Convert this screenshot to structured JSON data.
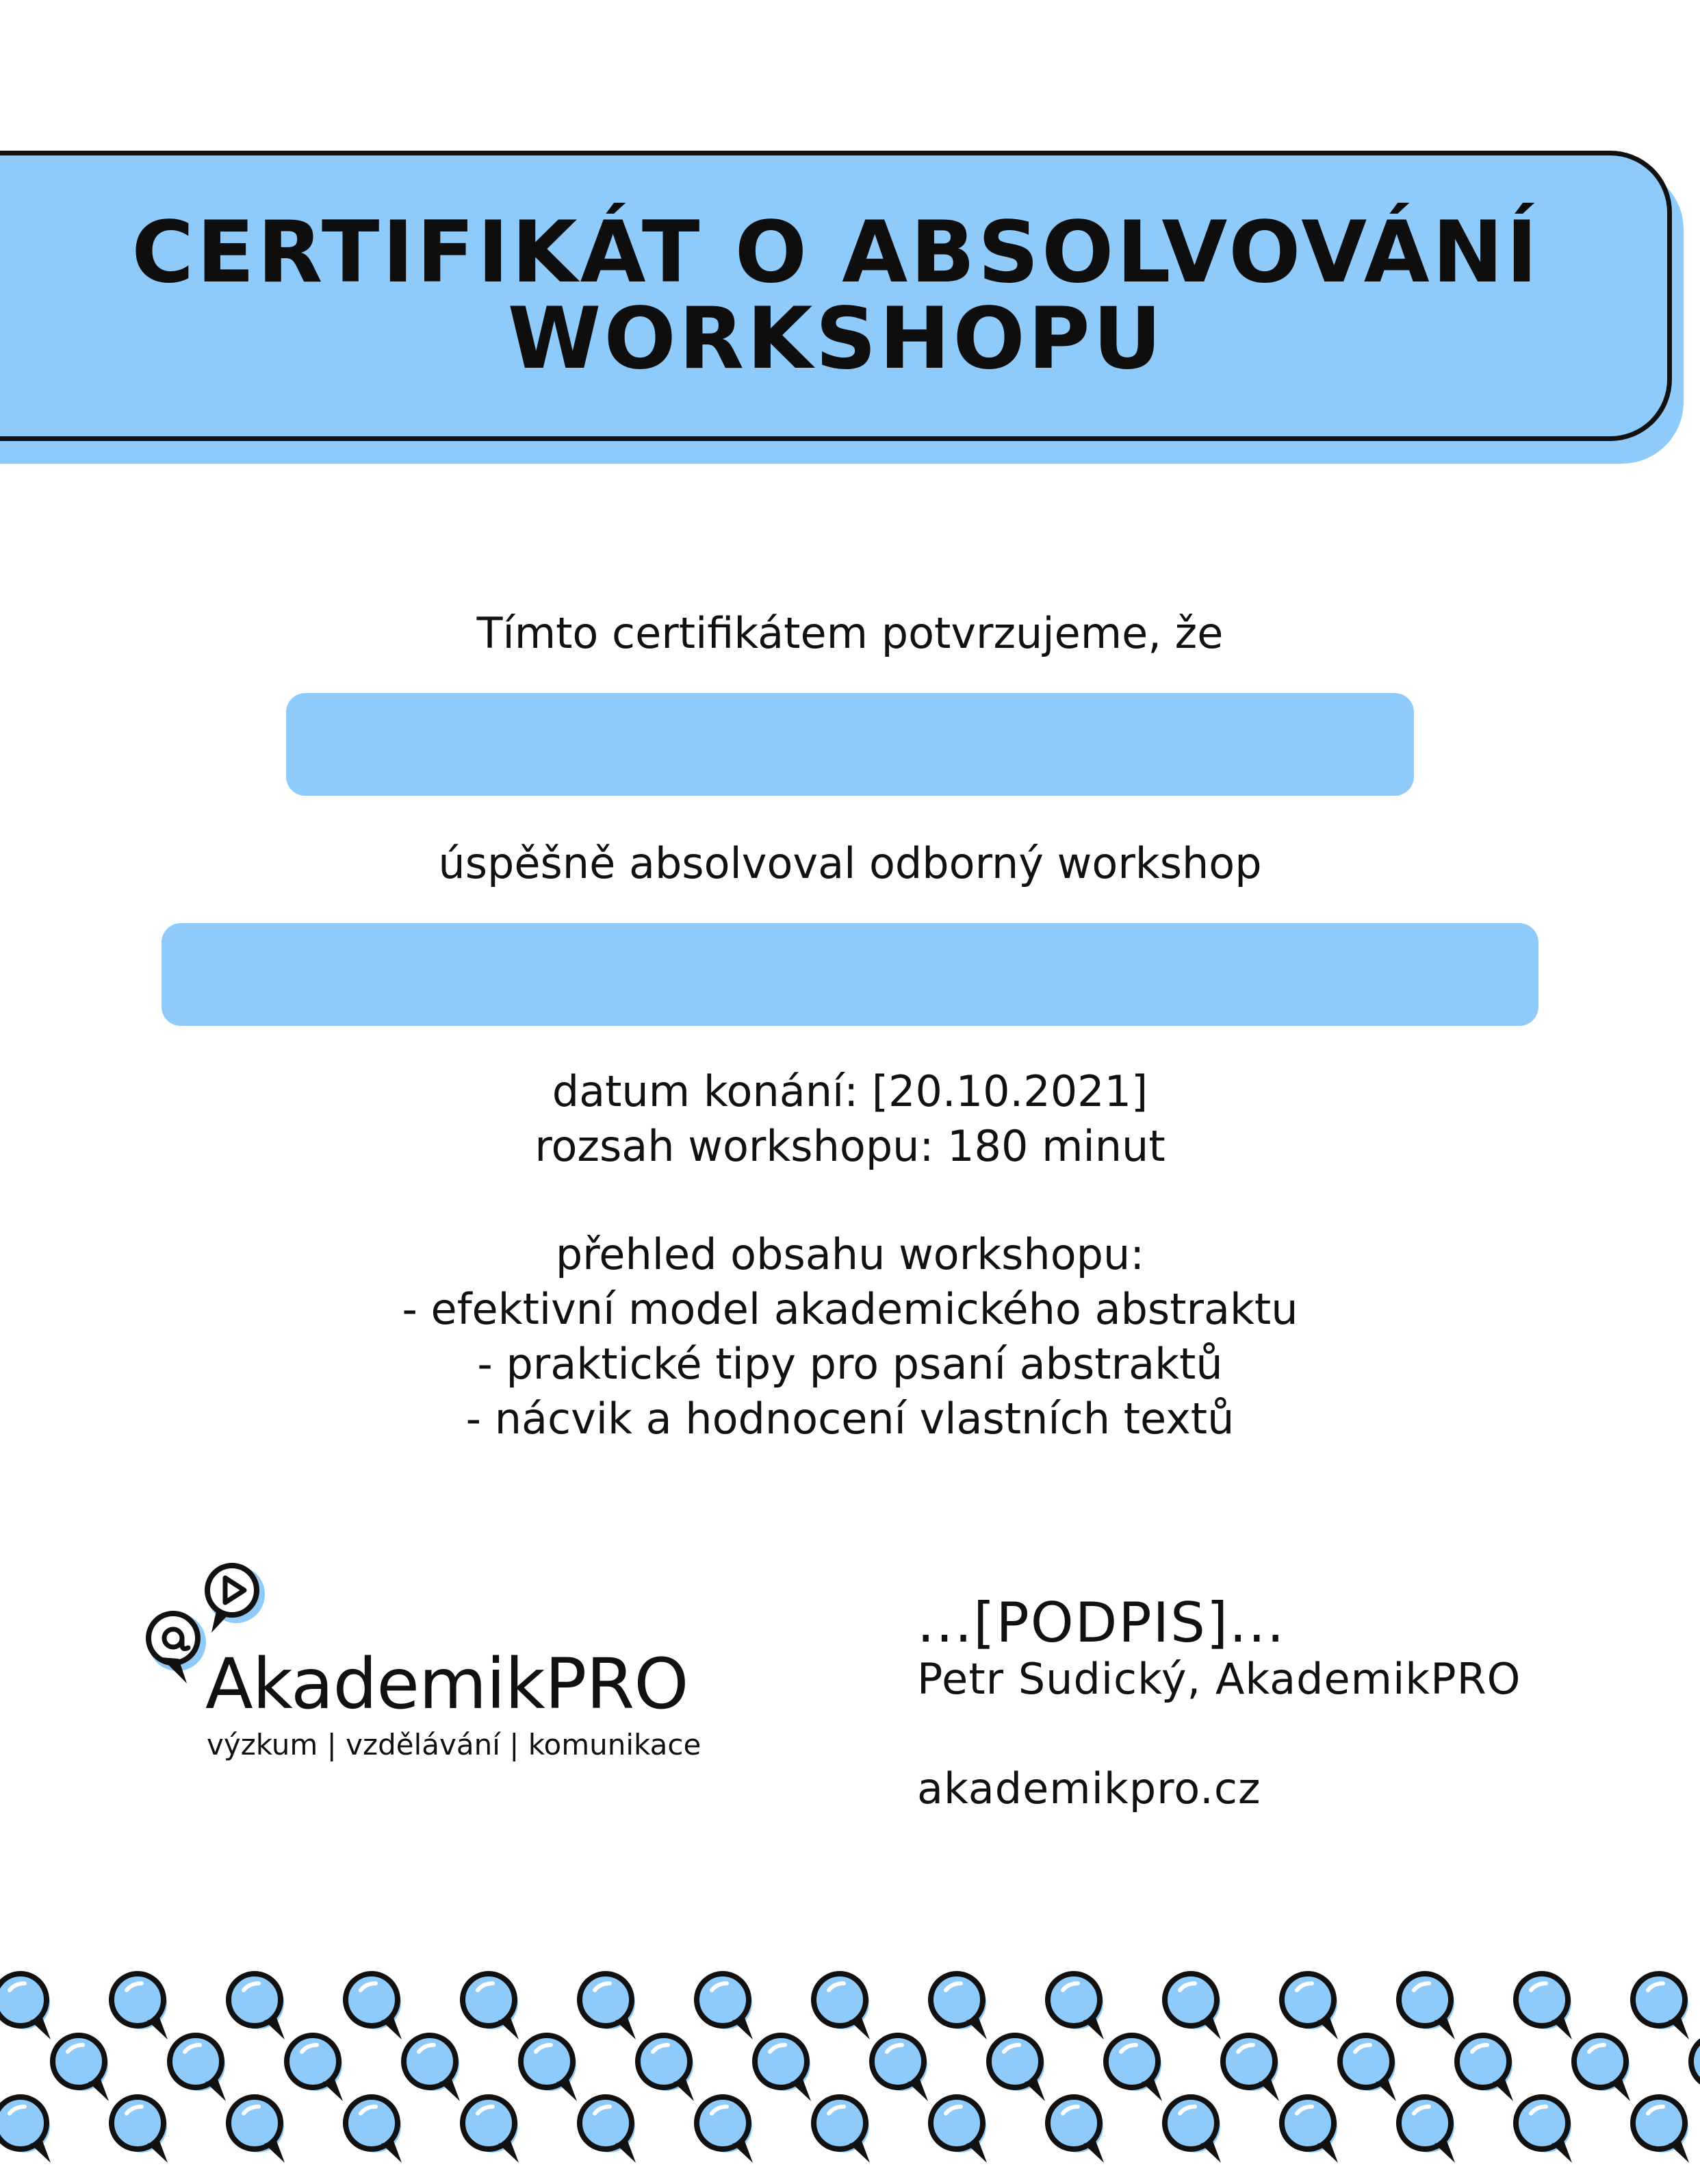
{
  "certificate": {
    "title_line1": "CERTIFIKÁT O ABSOLVOVÁNÍ",
    "title_line2": "WORKSHOPU",
    "intro": "Tímto certifikátem potvrzujeme, že",
    "name_value": "",
    "completion": "úspěšně absolvoval odborný workshop",
    "workshop_value": "",
    "date_line": "datum konání: [20.10.2021]",
    "duration_line": "rozsah workshopu: 180 minut",
    "overview_heading": "přehled obsahu workshopu:",
    "overview_items": [
      "- efektivní model akademického abstraktu",
      "- praktické tipy pro psaní abstraktů",
      "- nácvik a hodnocení vlastních textů"
    ]
  },
  "logo": {
    "name": "AkademikPRO",
    "tagline": "výzkum | vzdělávání | komunikace",
    "icons": [
      "at-sign-speech-bubble-icon",
      "play-speech-bubble-icon"
    ]
  },
  "signature": {
    "placeholder": "...[PODPIS]...",
    "signer": "Petr Sudický, AkademikPRO",
    "website": "akademikpro.cz"
  },
  "colors": {
    "accent_blue": "#8fcbfa",
    "ink": "#111111",
    "background": "#ffffff"
  },
  "decoration": {
    "pattern_icon": "speech-bubble-icon"
  }
}
